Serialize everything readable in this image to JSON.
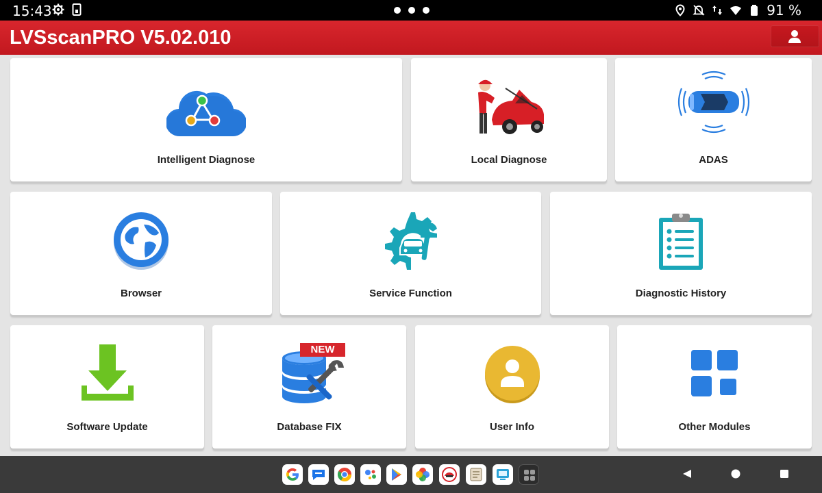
{
  "status_bar": {
    "time": "15:43",
    "left_icons": [
      "settings-gear-icon",
      "sim-card-icon"
    ],
    "right_icons": [
      "location-pin-icon",
      "notifications-off-icon",
      "data-transfer-icon",
      "wifi-icon",
      "battery-icon"
    ],
    "battery_percent": "91 %"
  },
  "app_bar": {
    "title": "LVSscanPRO V5.02.010",
    "user_button_icon": "user-icon"
  },
  "tiles": [
    {
      "label": "Intelligent Diagnose",
      "icon": "cloud-network-icon"
    },
    {
      "label": "Local Diagnose",
      "icon": "mechanic-car-icon"
    },
    {
      "label": "ADAS",
      "icon": "adas-car-radar-icon"
    },
    {
      "label": "Browser",
      "icon": "globe-icon"
    },
    {
      "label": "Service Function",
      "icon": "gear-car-wrench-icon"
    },
    {
      "label": "Diagnostic History",
      "icon": "clipboard-checklist-icon"
    },
    {
      "label": "Software Update",
      "icon": "download-arrow-icon"
    },
    {
      "label": "Database FIX",
      "icon": "database-tools-icon",
      "badge": "NEW"
    },
    {
      "label": "User Info",
      "icon": "user-circle-icon"
    },
    {
      "label": "Other Modules",
      "icon": "module-grid-icon"
    }
  ],
  "dock": {
    "apps": [
      "google-icon",
      "messages-icon",
      "chrome-icon",
      "assistant-icon",
      "play-store-icon",
      "photos-icon",
      "launch-app-icon",
      "reader-app-icon",
      "screen-app-icon",
      "app-drawer-icon"
    ]
  },
  "nav_buttons": [
    "back-icon",
    "home-icon",
    "recents-icon"
  ],
  "colors": {
    "app_bar": "#c8191f",
    "status_bar": "#000000",
    "nav_bar": "#3a3a3a",
    "background": "#e4e4e4",
    "accent_blue": "#2a7ee0",
    "accent_teal": "#1aa6b8",
    "accent_green": "#6cc322",
    "accent_yellow": "#e9b832"
  }
}
